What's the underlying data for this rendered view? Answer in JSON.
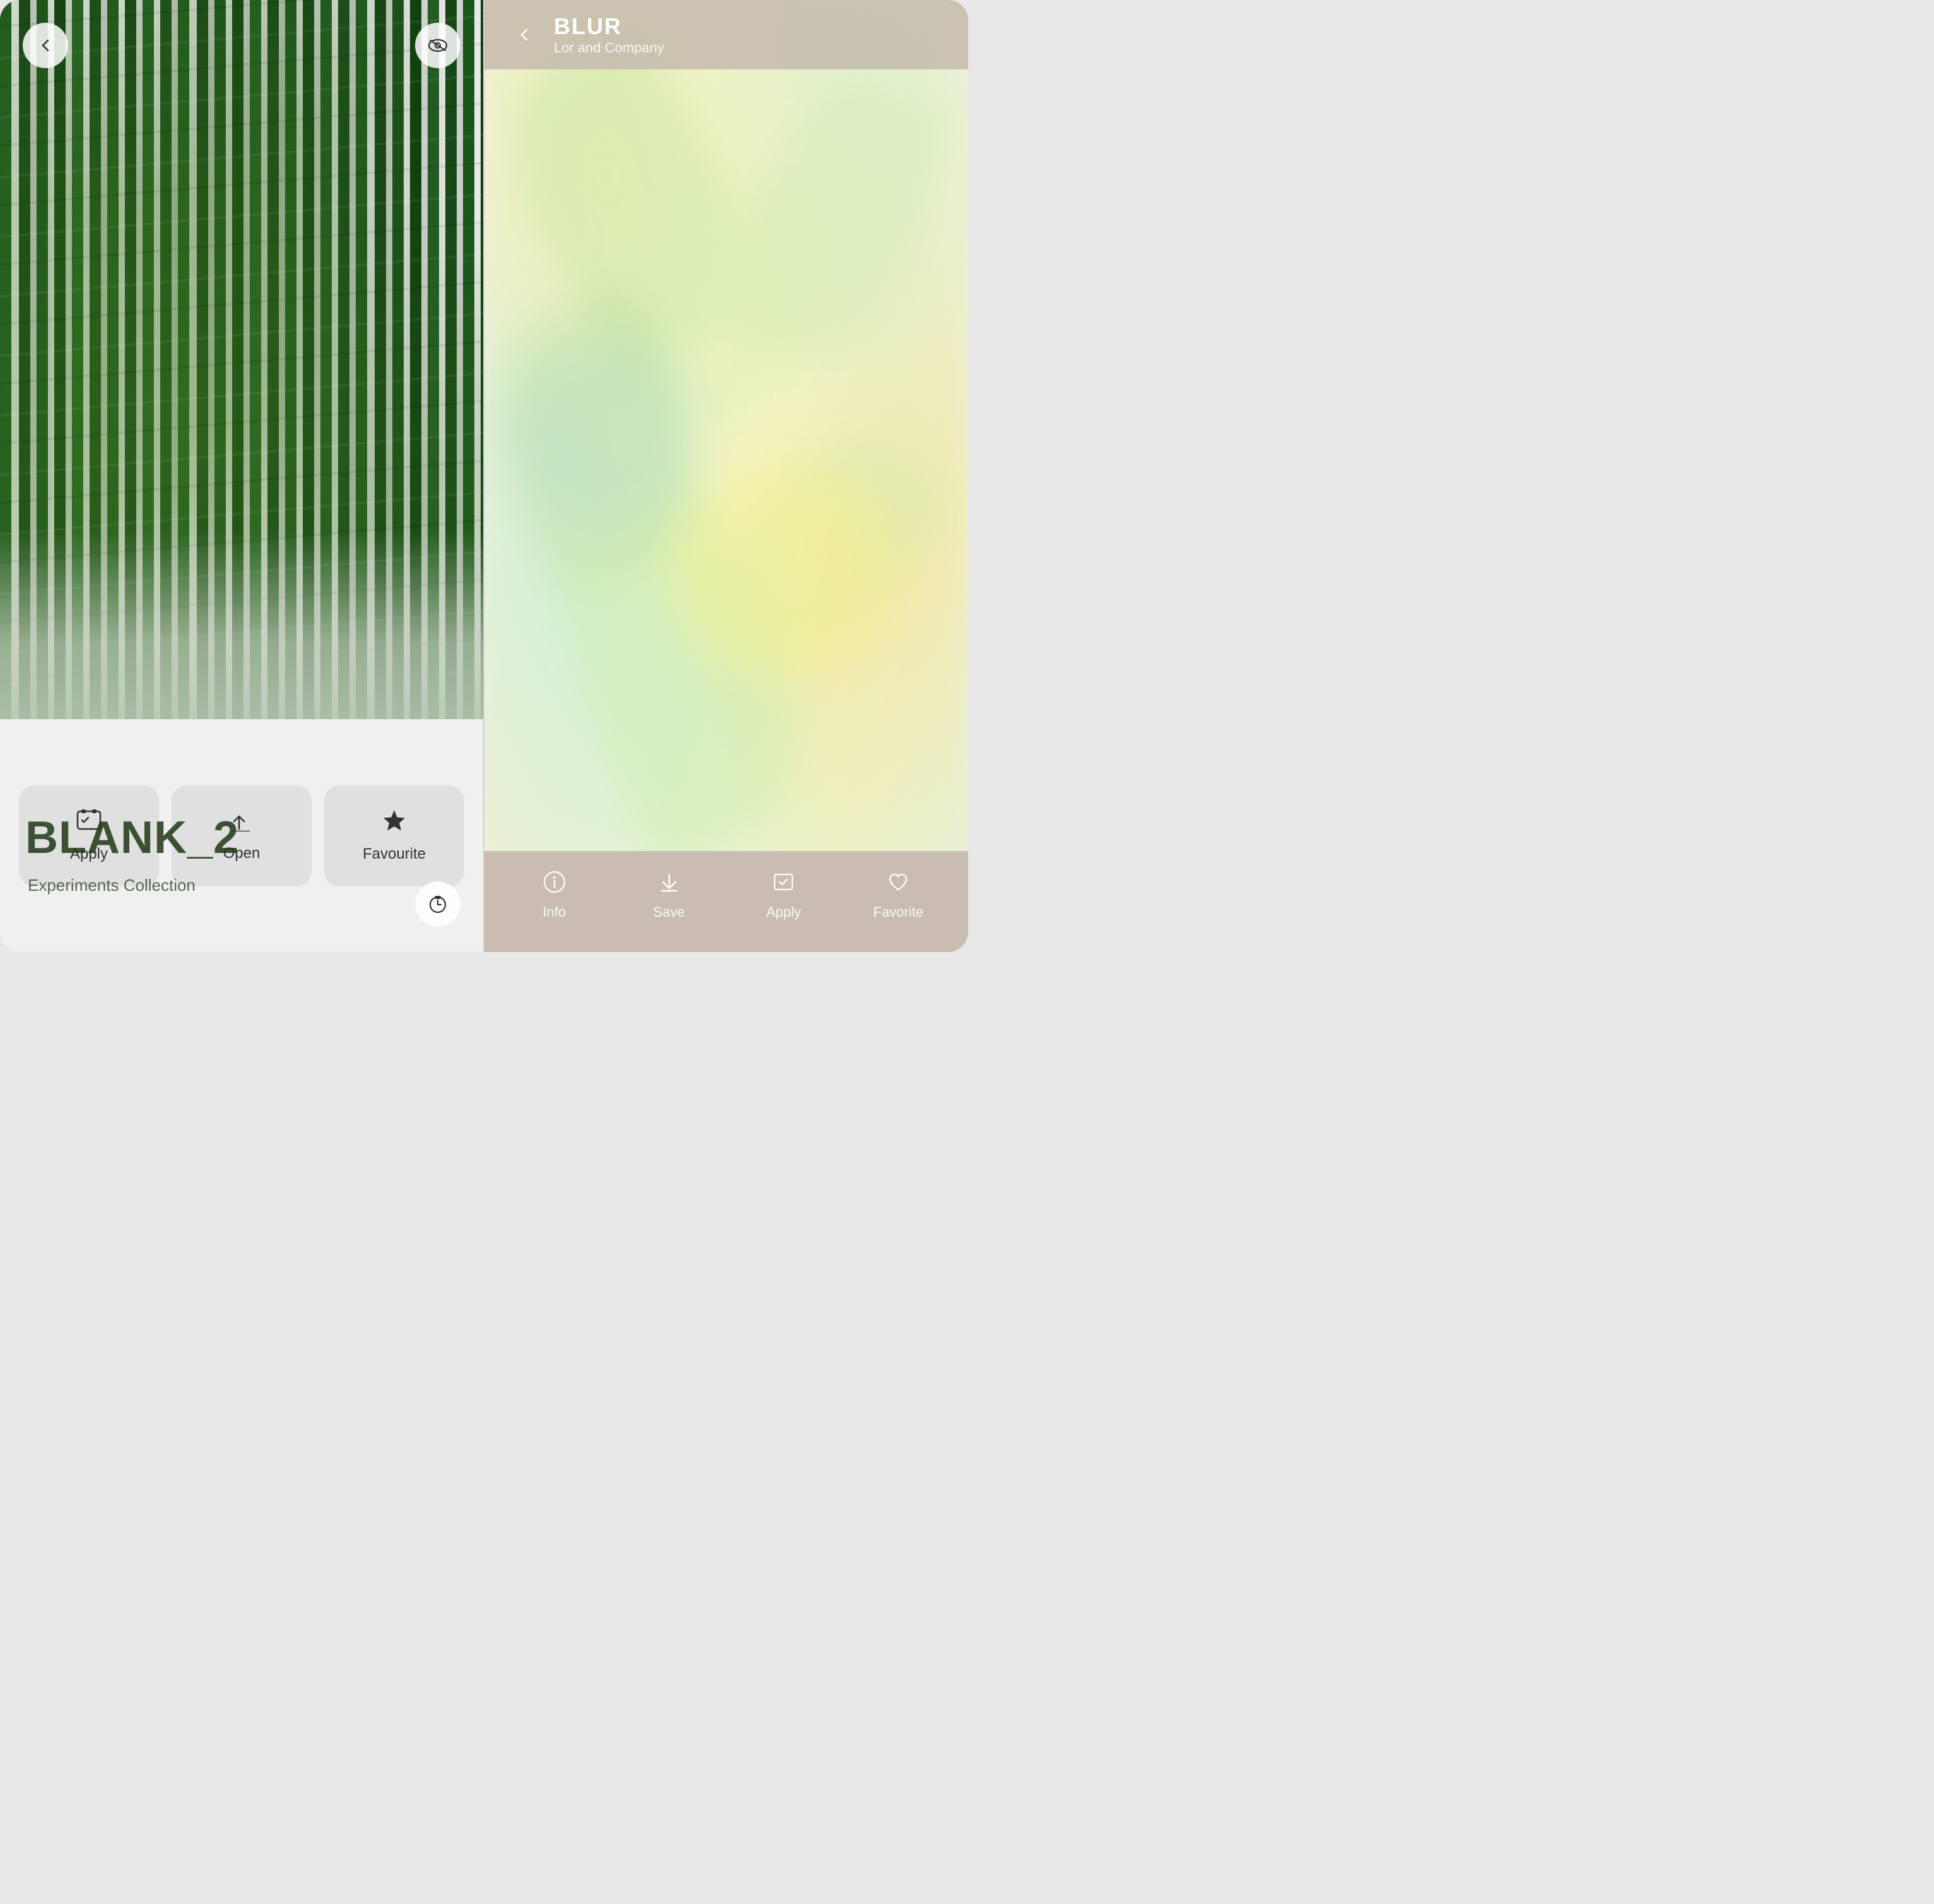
{
  "left": {
    "wallpaper_title": "BLANK_2",
    "wallpaper_subtitle": "Experiments Collection",
    "back_label": "←",
    "eye_icon": "👁",
    "timer_icon": "⏱",
    "actions": [
      {
        "id": "apply",
        "icon": "⊡",
        "label": "Apply"
      },
      {
        "id": "open",
        "icon": "✓",
        "label": "Open"
      },
      {
        "id": "favourite",
        "icon": "★",
        "label": "Favourite"
      }
    ]
  },
  "right": {
    "header": {
      "back_icon": "←",
      "title": "BLUR",
      "subtitle": "Lor and Company"
    },
    "tabs": [
      {
        "id": "info",
        "icon": "ℹ",
        "label": "Info"
      },
      {
        "id": "save",
        "icon": "⬇",
        "label": "Save"
      },
      {
        "id": "apply",
        "icon": "⊡",
        "label": "Apply"
      },
      {
        "id": "favorite",
        "icon": "♡",
        "label": "Favorite"
      }
    ]
  }
}
